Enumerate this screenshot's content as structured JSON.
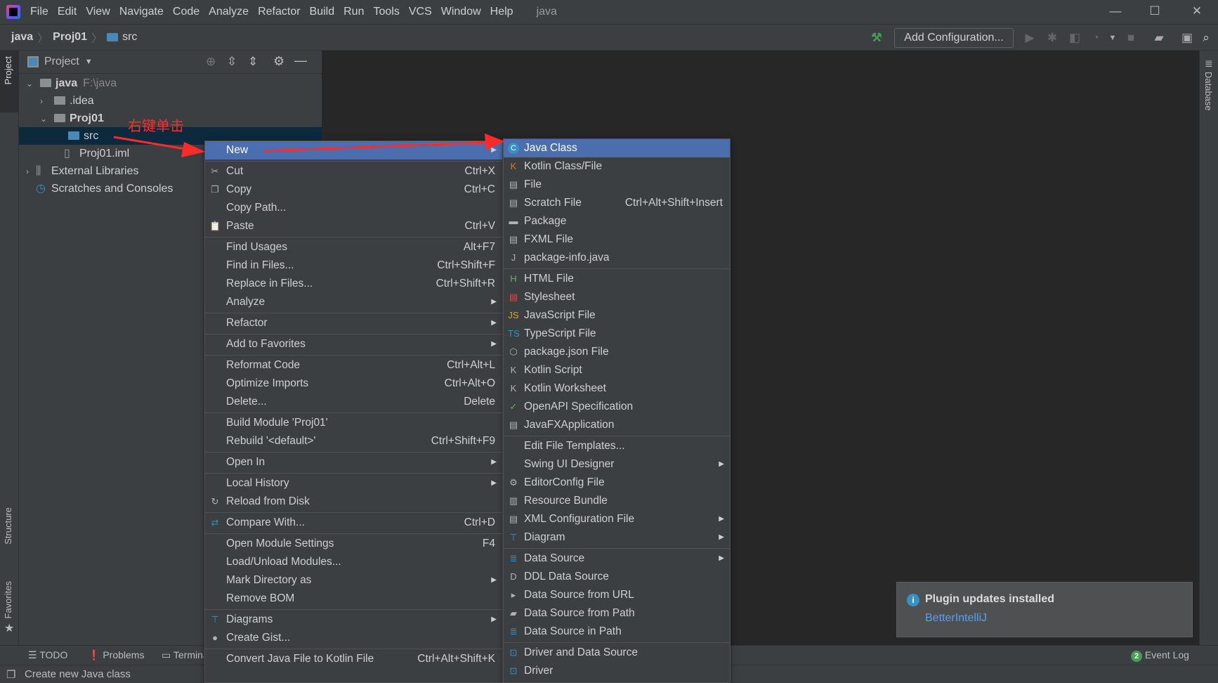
{
  "titlebar": {
    "menus": [
      "File",
      "Edit",
      "View",
      "Navigate",
      "Code",
      "Analyze",
      "Refactor",
      "Build",
      "Run",
      "Tools",
      "VCS",
      "Window",
      "Help"
    ],
    "title": "java"
  },
  "breadcrumb": [
    "java",
    "Proj01",
    "src"
  ],
  "toolbar": {
    "add_configuration": "Add Configuration..."
  },
  "side_tabs": {
    "project": "Project",
    "structure": "Structure",
    "favorites": "Favorites",
    "database": "Database"
  },
  "project_panel": {
    "title": "Project",
    "tree": [
      {
        "label": "java",
        "hint": "F:\\java",
        "expanded": true
      },
      {
        "label": ".idea",
        "expanded": false
      },
      {
        "label": "Proj01",
        "expanded": true
      },
      {
        "label": "src",
        "selected": true
      },
      {
        "label": "Proj01.iml"
      },
      {
        "label": "External Libraries",
        "expanded": false
      },
      {
        "label": "Scratches and Consoles"
      }
    ]
  },
  "annotation": {
    "text": "右键单击",
    "color": "#ff2a2a"
  },
  "context_menu": [
    {
      "label": "New",
      "submenu": true,
      "highlighted": true
    },
    {
      "sep": true
    },
    {
      "label": "Cut",
      "shortcut": "Ctrl+X",
      "icon": "scissors-icon"
    },
    {
      "label": "Copy",
      "shortcut": "Ctrl+C",
      "icon": "copy-icon"
    },
    {
      "label": "Copy Path..."
    },
    {
      "label": "Paste",
      "shortcut": "Ctrl+V",
      "icon": "paste-icon"
    },
    {
      "sep": true
    },
    {
      "label": "Find Usages",
      "shortcut": "Alt+F7"
    },
    {
      "label": "Find in Files...",
      "shortcut": "Ctrl+Shift+F"
    },
    {
      "label": "Replace in Files...",
      "shortcut": "Ctrl+Shift+R"
    },
    {
      "label": "Analyze",
      "submenu": true
    },
    {
      "sep": true
    },
    {
      "label": "Refactor",
      "submenu": true
    },
    {
      "sep": true
    },
    {
      "label": "Add to Favorites",
      "submenu": true
    },
    {
      "sep": true
    },
    {
      "label": "Reformat Code",
      "shortcut": "Ctrl+Alt+L"
    },
    {
      "label": "Optimize Imports",
      "shortcut": "Ctrl+Alt+O"
    },
    {
      "label": "Delete...",
      "shortcut": "Delete"
    },
    {
      "sep": true
    },
    {
      "label": "Build Module 'Proj01'"
    },
    {
      "label": "Rebuild '<default>'",
      "shortcut": "Ctrl+Shift+F9"
    },
    {
      "sep": true
    },
    {
      "label": "Open In",
      "submenu": true
    },
    {
      "sep": true
    },
    {
      "label": "Local History",
      "submenu": true
    },
    {
      "label": "Reload from Disk",
      "icon": "reload-icon"
    },
    {
      "sep": true
    },
    {
      "label": "Compare With...",
      "shortcut": "Ctrl+D",
      "icon": "compare-icon"
    },
    {
      "sep": true
    },
    {
      "label": "Open Module Settings",
      "shortcut": "F4"
    },
    {
      "label": "Load/Unload Modules..."
    },
    {
      "label": "Mark Directory as",
      "submenu": true
    },
    {
      "label": "Remove BOM"
    },
    {
      "sep": true
    },
    {
      "label": "Diagrams",
      "submenu": true,
      "icon": "diagram-icon"
    },
    {
      "label": "Create Gist...",
      "icon": "github-icon"
    },
    {
      "sep": true
    },
    {
      "label": "Convert Java File to Kotlin File",
      "shortcut": "Ctrl+Alt+Shift+K"
    }
  ],
  "new_submenu": [
    {
      "label": "Java Class",
      "highlighted": true,
      "icon": "java-class-icon"
    },
    {
      "label": "Kotlin Class/File",
      "icon": "kotlin-file-icon"
    },
    {
      "label": "File",
      "icon": "file-icon"
    },
    {
      "label": "Scratch File",
      "shortcut": "Ctrl+Alt+Shift+Insert",
      "icon": "scratch-file-icon"
    },
    {
      "label": "Package",
      "icon": "package-icon"
    },
    {
      "label": "FXML File",
      "icon": "fxml-file-icon"
    },
    {
      "label": "package-info.java",
      "icon": "java-file-icon"
    },
    {
      "sep": true
    },
    {
      "label": "HTML File",
      "icon": "html-file-icon"
    },
    {
      "label": "Stylesheet",
      "icon": "css-file-icon"
    },
    {
      "label": "JavaScript File",
      "icon": "js-file-icon"
    },
    {
      "label": "TypeScript File",
      "icon": "ts-file-icon"
    },
    {
      "label": "package.json File",
      "icon": "npm-icon"
    },
    {
      "label": "Kotlin Script",
      "icon": "kotlin-script-icon"
    },
    {
      "label": "Kotlin Worksheet",
      "icon": "kotlin-worksheet-icon"
    },
    {
      "label": "OpenAPI Specification",
      "icon": "openapi-icon"
    },
    {
      "label": "JavaFXApplication",
      "icon": "javafx-icon"
    },
    {
      "sep": true
    },
    {
      "label": "Edit File Templates..."
    },
    {
      "label": "Swing UI Designer",
      "submenu": true
    },
    {
      "label": "EditorConfig File",
      "icon": "gear-icon"
    },
    {
      "label": "Resource Bundle",
      "icon": "resource-bundle-icon"
    },
    {
      "label": "XML Configuration File",
      "submenu": true,
      "icon": "xml-file-icon"
    },
    {
      "label": "Diagram",
      "submenu": true,
      "icon": "diagram-icon"
    },
    {
      "sep": true
    },
    {
      "label": "Data Source",
      "submenu": true,
      "icon": "database-icon"
    },
    {
      "label": "DDL Data Source",
      "icon": "ddl-icon"
    },
    {
      "label": "Data Source from URL",
      "icon": "url-icon"
    },
    {
      "label": "Data Source from Path",
      "icon": "folder-icon"
    },
    {
      "label": "Data Source in Path",
      "icon": "database-icon"
    },
    {
      "sep": true
    },
    {
      "label": "Driver and Data Source",
      "icon": "driver-icon"
    },
    {
      "label": "Driver",
      "icon": "driver-icon"
    }
  ],
  "bottom_tabs": [
    "TODO",
    "Problems",
    "Terminal"
  ],
  "event_log": {
    "label": "Event Log",
    "count": "2"
  },
  "status": "Create new Java class",
  "notification": {
    "title": "Plugin updates installed",
    "link": "BetterIntelliJ"
  },
  "colors": {
    "highlight": "#4b6eaf",
    "selection": "#0d293e",
    "link": "#589df6",
    "background": "#3c3f41",
    "editor": "#272727"
  }
}
